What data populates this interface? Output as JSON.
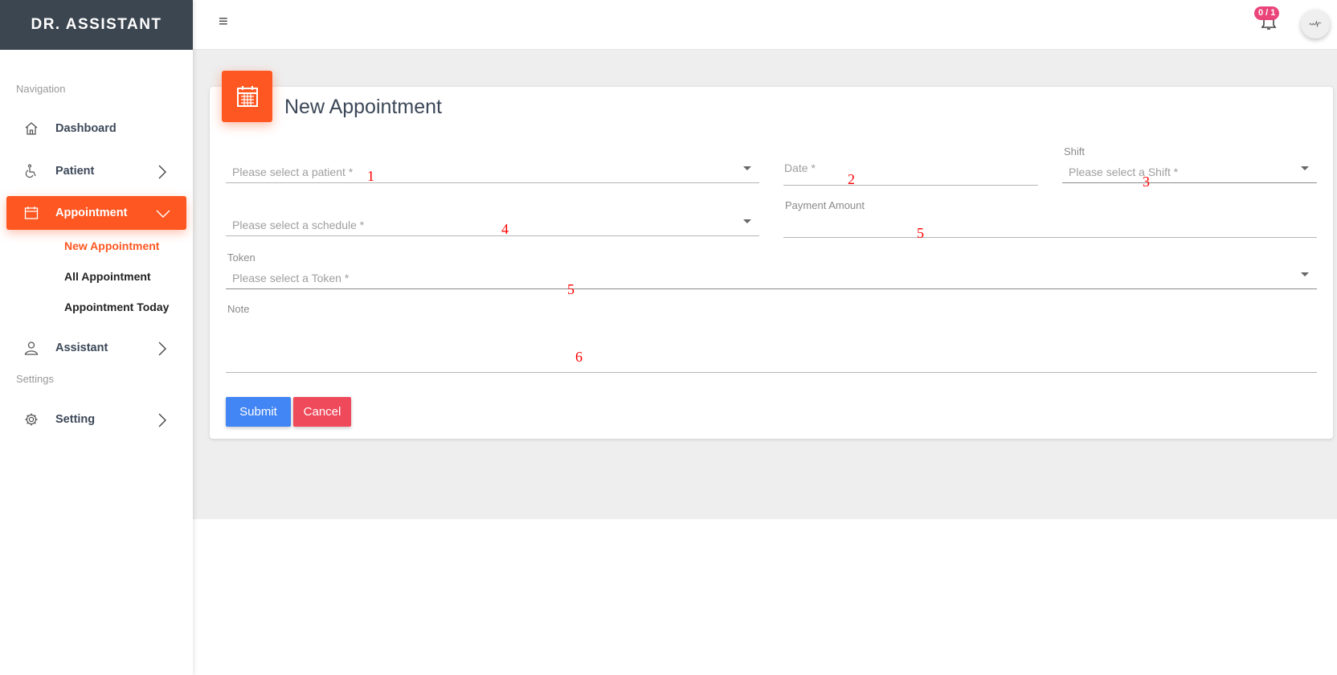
{
  "brand": "DR. ASSISTANT",
  "colors": {
    "accent": "#ff5722",
    "submit": "#4285f4",
    "cancel": "#ef4a5b",
    "badge": "#e9457b"
  },
  "sidebar": {
    "section_navigation": "Navigation",
    "section_settings": "Settings",
    "items": [
      {
        "label": "Dashboard",
        "icon": "home-icon"
      },
      {
        "label": "Patient",
        "icon": "wheelchair-icon"
      },
      {
        "label": "Appointment",
        "icon": "calendar-icon",
        "active": true
      },
      {
        "label": "Assistant",
        "icon": "user-icon"
      },
      {
        "label": "Setting",
        "icon": "gear-icon"
      }
    ],
    "appointment_sub": [
      {
        "label": "New Appointment",
        "active": true
      },
      {
        "label": "All Appointment"
      },
      {
        "label": "Appointment Today"
      }
    ]
  },
  "topbar": {
    "menu_glyph": "≡",
    "notification_badge": "0 / 1"
  },
  "card": {
    "title": "New Appointment",
    "icon": "calendar-icon"
  },
  "form": {
    "patient_placeholder": "Please select a patient *",
    "date_placeholder": "Date  *",
    "shift_label": "Shift",
    "shift_placeholder": "Please select a Shift *",
    "schedule_placeholder": "Please select a schedule *",
    "payment_label": "Payment Amount",
    "payment_value": "",
    "token_label": "Token",
    "token_placeholder": "Please select a Token *",
    "note_label": "Note",
    "note_value": "",
    "submit": "Submit",
    "cancel": "Cancel"
  },
  "markers": [
    "1",
    "2",
    "3",
    "4",
    "5",
    "5",
    "6"
  ]
}
